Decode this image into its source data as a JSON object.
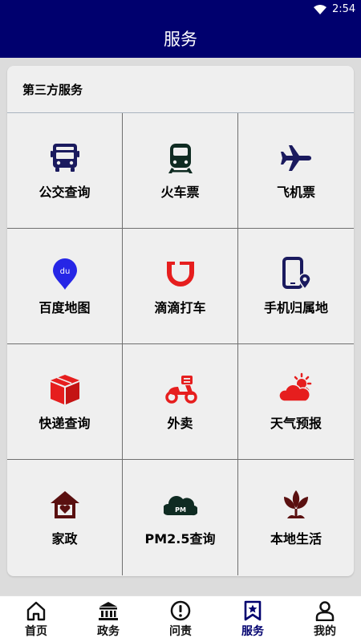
{
  "status_bar": {
    "time": "2:54"
  },
  "header": {
    "title": "服务"
  },
  "section": {
    "title": "第三方服务"
  },
  "services": [
    {
      "label": "公交查询",
      "icon": "bus-icon",
      "color": "#1a1a5e"
    },
    {
      "label": "火车票",
      "icon": "train-icon",
      "color": "#0f2b22"
    },
    {
      "label": "飞机票",
      "icon": "airplane-icon",
      "color": "#1a1a5e"
    },
    {
      "label": "百度地图",
      "icon": "baidu-map-pin-icon",
      "color": "#2626e6"
    },
    {
      "label": "滴滴打车",
      "icon": "didi-icon",
      "color": "#e61e1e"
    },
    {
      "label": "手机归属地",
      "icon": "phone-location-icon",
      "color": "#1a1a5e"
    },
    {
      "label": "快递查询",
      "icon": "package-icon",
      "color": "#e61e1e"
    },
    {
      "label": "外卖",
      "icon": "delivery-scooter-icon",
      "color": "#e61e1e"
    },
    {
      "label": "天气预报",
      "icon": "weather-sun-cloud-icon",
      "color": "#e61e1e"
    },
    {
      "label": "家政",
      "icon": "house-heart-icon",
      "color": "#5a1010"
    },
    {
      "label": "PM2.5查询",
      "icon": "pm25-cloud-icon",
      "color": "#0f2b22"
    },
    {
      "label": "本地生活",
      "icon": "lotus-icon",
      "color": "#5a1010"
    }
  ],
  "tabs": [
    {
      "label": "首页",
      "icon": "home-icon"
    },
    {
      "label": "政务",
      "icon": "government-building-icon"
    },
    {
      "label": "问责",
      "icon": "exclamation-circle-icon"
    },
    {
      "label": "服务",
      "icon": "bookmark-star-icon",
      "active": true
    },
    {
      "label": "我的",
      "icon": "user-icon"
    }
  ],
  "colors": {
    "primary": "#00006e",
    "card_background": "#efefef",
    "page_background": "#dcdcdc"
  }
}
